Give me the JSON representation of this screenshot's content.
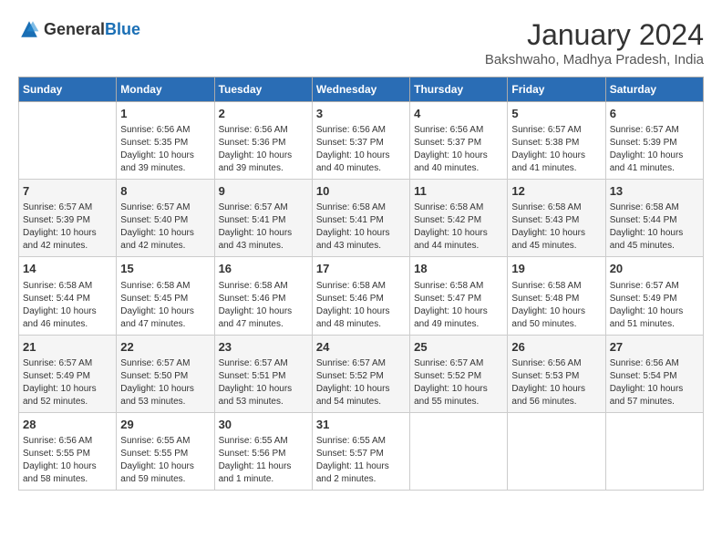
{
  "header": {
    "logo_general": "General",
    "logo_blue": "Blue",
    "month_year": "January 2024",
    "location": "Bakshwaho, Madhya Pradesh, India"
  },
  "days_of_week": [
    "Sunday",
    "Monday",
    "Tuesday",
    "Wednesday",
    "Thursday",
    "Friday",
    "Saturday"
  ],
  "weeks": [
    [
      {
        "day": "",
        "info": ""
      },
      {
        "day": "1",
        "info": "Sunrise: 6:56 AM\nSunset: 5:35 PM\nDaylight: 10 hours\nand 39 minutes."
      },
      {
        "day": "2",
        "info": "Sunrise: 6:56 AM\nSunset: 5:36 PM\nDaylight: 10 hours\nand 39 minutes."
      },
      {
        "day": "3",
        "info": "Sunrise: 6:56 AM\nSunset: 5:37 PM\nDaylight: 10 hours\nand 40 minutes."
      },
      {
        "day": "4",
        "info": "Sunrise: 6:56 AM\nSunset: 5:37 PM\nDaylight: 10 hours\nand 40 minutes."
      },
      {
        "day": "5",
        "info": "Sunrise: 6:57 AM\nSunset: 5:38 PM\nDaylight: 10 hours\nand 41 minutes."
      },
      {
        "day": "6",
        "info": "Sunrise: 6:57 AM\nSunset: 5:39 PM\nDaylight: 10 hours\nand 41 minutes."
      }
    ],
    [
      {
        "day": "7",
        "info": "Sunrise: 6:57 AM\nSunset: 5:39 PM\nDaylight: 10 hours\nand 42 minutes."
      },
      {
        "day": "8",
        "info": "Sunrise: 6:57 AM\nSunset: 5:40 PM\nDaylight: 10 hours\nand 42 minutes."
      },
      {
        "day": "9",
        "info": "Sunrise: 6:57 AM\nSunset: 5:41 PM\nDaylight: 10 hours\nand 43 minutes."
      },
      {
        "day": "10",
        "info": "Sunrise: 6:58 AM\nSunset: 5:41 PM\nDaylight: 10 hours\nand 43 minutes."
      },
      {
        "day": "11",
        "info": "Sunrise: 6:58 AM\nSunset: 5:42 PM\nDaylight: 10 hours\nand 44 minutes."
      },
      {
        "day": "12",
        "info": "Sunrise: 6:58 AM\nSunset: 5:43 PM\nDaylight: 10 hours\nand 45 minutes."
      },
      {
        "day": "13",
        "info": "Sunrise: 6:58 AM\nSunset: 5:44 PM\nDaylight: 10 hours\nand 45 minutes."
      }
    ],
    [
      {
        "day": "14",
        "info": "Sunrise: 6:58 AM\nSunset: 5:44 PM\nDaylight: 10 hours\nand 46 minutes."
      },
      {
        "day": "15",
        "info": "Sunrise: 6:58 AM\nSunset: 5:45 PM\nDaylight: 10 hours\nand 47 minutes."
      },
      {
        "day": "16",
        "info": "Sunrise: 6:58 AM\nSunset: 5:46 PM\nDaylight: 10 hours\nand 47 minutes."
      },
      {
        "day": "17",
        "info": "Sunrise: 6:58 AM\nSunset: 5:46 PM\nDaylight: 10 hours\nand 48 minutes."
      },
      {
        "day": "18",
        "info": "Sunrise: 6:58 AM\nSunset: 5:47 PM\nDaylight: 10 hours\nand 49 minutes."
      },
      {
        "day": "19",
        "info": "Sunrise: 6:58 AM\nSunset: 5:48 PM\nDaylight: 10 hours\nand 50 minutes."
      },
      {
        "day": "20",
        "info": "Sunrise: 6:57 AM\nSunset: 5:49 PM\nDaylight: 10 hours\nand 51 minutes."
      }
    ],
    [
      {
        "day": "21",
        "info": "Sunrise: 6:57 AM\nSunset: 5:49 PM\nDaylight: 10 hours\nand 52 minutes."
      },
      {
        "day": "22",
        "info": "Sunrise: 6:57 AM\nSunset: 5:50 PM\nDaylight: 10 hours\nand 53 minutes."
      },
      {
        "day": "23",
        "info": "Sunrise: 6:57 AM\nSunset: 5:51 PM\nDaylight: 10 hours\nand 53 minutes."
      },
      {
        "day": "24",
        "info": "Sunrise: 6:57 AM\nSunset: 5:52 PM\nDaylight: 10 hours\nand 54 minutes."
      },
      {
        "day": "25",
        "info": "Sunrise: 6:57 AM\nSunset: 5:52 PM\nDaylight: 10 hours\nand 55 minutes."
      },
      {
        "day": "26",
        "info": "Sunrise: 6:56 AM\nSunset: 5:53 PM\nDaylight: 10 hours\nand 56 minutes."
      },
      {
        "day": "27",
        "info": "Sunrise: 6:56 AM\nSunset: 5:54 PM\nDaylight: 10 hours\nand 57 minutes."
      }
    ],
    [
      {
        "day": "28",
        "info": "Sunrise: 6:56 AM\nSunset: 5:55 PM\nDaylight: 10 hours\nand 58 minutes."
      },
      {
        "day": "29",
        "info": "Sunrise: 6:55 AM\nSunset: 5:55 PM\nDaylight: 10 hours\nand 59 minutes."
      },
      {
        "day": "30",
        "info": "Sunrise: 6:55 AM\nSunset: 5:56 PM\nDaylight: 11 hours\nand 1 minute."
      },
      {
        "day": "31",
        "info": "Sunrise: 6:55 AM\nSunset: 5:57 PM\nDaylight: 11 hours\nand 2 minutes."
      },
      {
        "day": "",
        "info": ""
      },
      {
        "day": "",
        "info": ""
      },
      {
        "day": "",
        "info": ""
      }
    ]
  ]
}
